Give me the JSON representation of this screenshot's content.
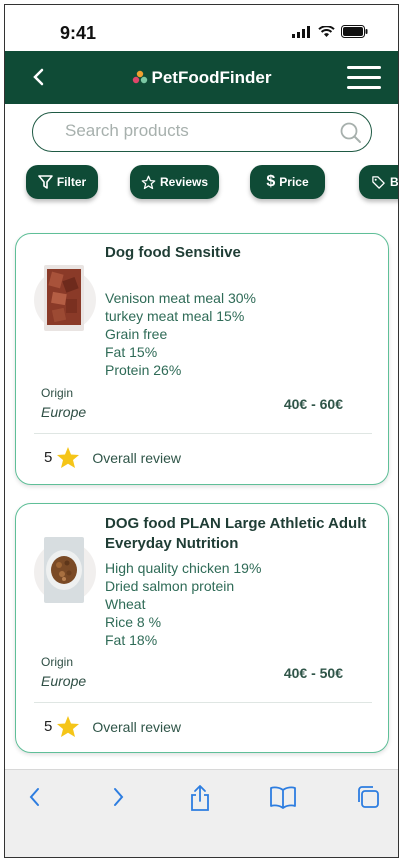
{
  "status": {
    "time": "9:41"
  },
  "header": {
    "title": "PetFoodFinder"
  },
  "search": {
    "placeholder": "Search products"
  },
  "chips": [
    "Filter",
    "Reviews",
    "Price",
    "B"
  ],
  "products": [
    {
      "name": "Dog food Sensitive",
      "ingredients": [
        "Venison meat meal 30%",
        "turkey meat meal 15%",
        "Grain free",
        "Fat 15%",
        "Protein 26%"
      ],
      "origin_label": "Origin",
      "origin": "Europe",
      "price": "40€ - 60€",
      "rating": "5",
      "rating_label": "Overall review"
    },
    {
      "name": "DOG food PLAN Large Athletic Adult Everyday Nutrition",
      "ingredients": [
        "High quality chicken 19%",
        "Dried salmon protein",
        "Wheat",
        "Rice 8 %",
        "Fat 18%"
      ],
      "origin_label": "Origin",
      "origin": "Europe",
      "price": "40€ - 50€",
      "rating": "5",
      "rating_label": "Overall review"
    }
  ],
  "colors": {
    "primary": "#0f4b36",
    "card_border": "#5fbf98",
    "star": "#f5c518"
  }
}
